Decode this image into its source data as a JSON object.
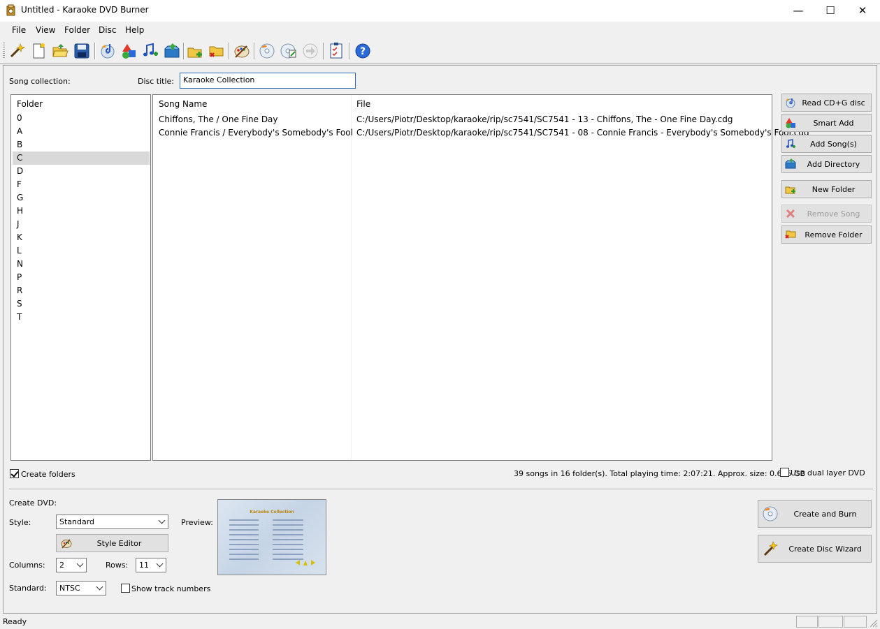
{
  "window": {
    "title": "Untitled - Karaoke DVD Burner",
    "minimize_glyph": "—",
    "maximize_glyph": "☐",
    "close_glyph": "✕"
  },
  "menu": [
    "File",
    "View",
    "Folder",
    "Disc",
    "Help"
  ],
  "toolbar": {
    "icons": [
      "wizard-icon",
      "new-document-icon",
      "open-folder-icon",
      "save-icon",
      "read-cdg-icon",
      "smart-add-icon",
      "add-song-icon",
      "add-directory-icon",
      "new-folder-icon",
      "remove-folder-icon",
      "style-editor-icon",
      "create-burn-icon",
      "burn-settings-icon",
      "forward-icon",
      "checklist-icon",
      "help-icon"
    ]
  },
  "main": {
    "song_collection_label": "Song collection:",
    "disc_title_label": "Disc title:",
    "disc_title_value": "Karaoke Collection"
  },
  "folders": {
    "header": "Folder",
    "items": [
      "0",
      "A",
      "B",
      "C",
      "D",
      "F",
      "G",
      "H",
      "J",
      "K",
      "L",
      "N",
      "P",
      "R",
      "S",
      "T"
    ],
    "selected": "C"
  },
  "songs": {
    "columns": [
      "Song Name",
      "File"
    ],
    "rows": [
      {
        "name": "Chiffons, The / One Fine Day",
        "file": "C:/Users/Piotr/Desktop/karaoke/rip/sc7541/SC7541 - 13 - Chiffons, The - One Fine Day.cdg"
      },
      {
        "name": "Connie Francis / Everybody's Somebody's Fool",
        "file": "C:/Users/Piotr/Desktop/karaoke/rip/sc7541/SC7541 - 08 - Connie Francis - Everybody's Somebody's Fool.cdg"
      }
    ]
  },
  "side_buttons": {
    "read_cdg": "Read CD+G disc",
    "smart_add": "Smart Add",
    "add_songs": "Add Song(s)",
    "add_directory": "Add Directory",
    "new_folder": "New Folder",
    "remove_song": "Remove Song",
    "remove_folder": "Remove Folder"
  },
  "options": {
    "create_folders_label": "Create folders",
    "create_folders_checked": true,
    "summary": "39 songs in 16 folder(s). Total playing time: 2:07:21. Approx. size: 0.695 GB",
    "dual_layer_label": "Use dual layer DVD",
    "dual_layer_checked": false
  },
  "create_dvd": {
    "section_label": "Create DVD:",
    "style_label": "Style:",
    "style_value": "Standard",
    "style_editor_label": "Style Editor",
    "preview_label": "Preview:",
    "preview_title": "Karaoke Collection",
    "columns_label": "Columns:",
    "columns_value": "2",
    "rows_label": "Rows:",
    "rows_value": "11",
    "standard_label": "Standard:",
    "standard_value": "NTSC",
    "show_track_numbers_label": "Show track numbers",
    "show_track_numbers_checked": false,
    "create_burn_label": "Create and Burn",
    "wizard_label": "Create Disc Wizard"
  },
  "status": {
    "text": "Ready"
  },
  "colors": {
    "selection": "#d9d9d9",
    "focus_border": "#2f6fba",
    "preview_title": "#b8860b"
  }
}
